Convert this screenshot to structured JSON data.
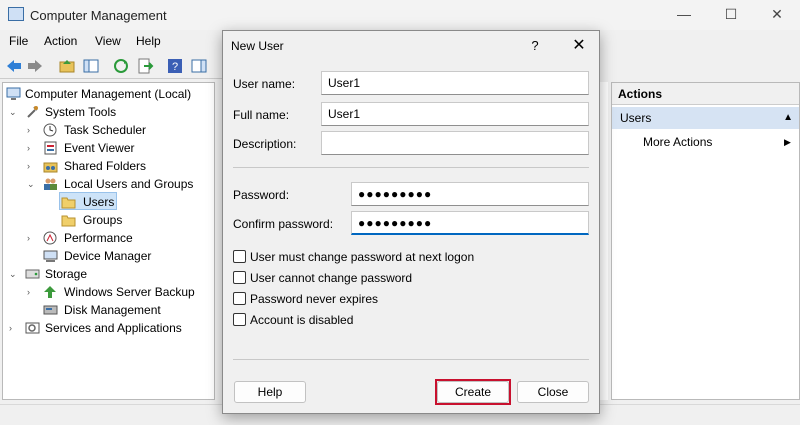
{
  "window": {
    "title": "Computer Management",
    "minimize": "—",
    "maximize": "☐",
    "close": "✕"
  },
  "menu": [
    "File",
    "Action",
    "View",
    "Help"
  ],
  "tree": {
    "root": "Computer Management (Local)",
    "system_tools": "System Tools",
    "task_scheduler": "Task Scheduler",
    "event_viewer": "Event Viewer",
    "shared_folders": "Shared Folders",
    "local_users_groups": "Local Users and Groups",
    "users": "Users",
    "groups": "Groups",
    "performance": "Performance",
    "device_manager": "Device Manager",
    "storage": "Storage",
    "windows_server_backup": "Windows Server Backup",
    "disk_management": "Disk Management",
    "services_applications": "Services and Applications"
  },
  "actions": {
    "header": "Actions",
    "users": "Users",
    "more_actions": "More Actions",
    "collapse_glyph": "▲",
    "more_glyph": "▶"
  },
  "dialog": {
    "title": "New User",
    "help_glyph": "?",
    "close_glyph": "✕",
    "user_name_label": "User name:",
    "user_name_value": "User1",
    "full_name_label": "Full name:",
    "full_name_value": "User1",
    "description_label": "Description:",
    "description_value": "",
    "password_label": "Password:",
    "password_value": "●●●●●●●●●",
    "confirm_label": "Confirm password:",
    "confirm_value": "●●●●●●●●●",
    "options": [
      {
        "label": "User must change password at next logon",
        "checked": false
      },
      {
        "label": "User cannot change password",
        "checked": false
      },
      {
        "label": "Password never expires",
        "checked": false
      },
      {
        "label": "Account is disabled",
        "checked": false
      }
    ],
    "help_button": "Help",
    "create_button": "Create",
    "close_button": "Close"
  },
  "colors": {
    "accent": "#0067c0",
    "highlight": "#c8102e",
    "selection": "#cde3f8"
  }
}
